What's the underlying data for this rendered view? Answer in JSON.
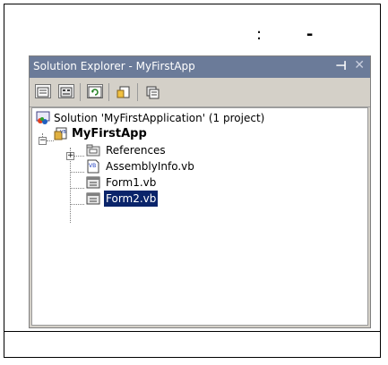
{
  "caption": {
    "colon": ":",
    "dash": "-"
  },
  "panel": {
    "title": "Solution Explorer - MyFirstApp",
    "pin_glyph": "⊣",
    "close_glyph": "✕"
  },
  "toolbar": {
    "buttons": [
      "properties-icon",
      "show-all-files-icon",
      "refresh-icon",
      "view-code-icon",
      "view-designer-icon"
    ]
  },
  "tree": {
    "solution": "Solution 'MyFirstApplication' (1 project)",
    "project": "MyFirstApp",
    "items": [
      "References",
      "AssemblyInfo.vb",
      "Form1.vb",
      "Form2.vb"
    ],
    "selected": "Form2.vb"
  },
  "colors": {
    "titlebar": "#6b7b99",
    "selection": "#0a246a",
    "panel": "#d4d0c8"
  }
}
